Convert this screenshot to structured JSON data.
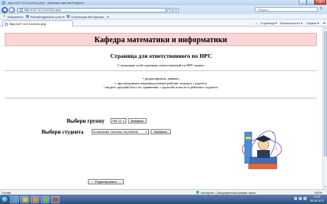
{
  "window": {
    "title": "http://127.0.0.1/c/1111.php - Windows Internet Explorer"
  },
  "address_bar": {
    "url": "http://127.0.0.1/c/1111.php",
    "search_placeholder": "Яндекс"
  },
  "favorites_bar": {
    "label": "Избранное",
    "items": [
      "Рекомендуемые узлы ▾",
      "Коллекция веб-фрагм... ▾"
    ]
  },
  "tab": {
    "title": "http://127.0.0.1/c/1111.php"
  },
  "command_bar": {
    "items": [
      "Страница ▾",
      "Безопасность ▾",
      "Сервис ▾",
      "?▾"
    ]
  },
  "page": {
    "banner": "Кафедра математики и информатики",
    "heading": "Страница для ответственного по НРС",
    "note": "С помощью этой страницы ответственный по НРС может:",
    "bullets": [
      "редактировать данные;",
      "просматривать индивидуальный рейтинг каждого студента;",
      "видеть средний балл по сравнению с группой и место в рейтинге студента."
    ],
    "group_label": "Выбери группу",
    "group_value": "ПМ-02",
    "group_button": "Выбрать",
    "student_label": "Выбери студента",
    "student_value": "Колмакова Татьяна Сергеевна",
    "student_button": "Выбрать",
    "edit_button": "Редактировать"
  },
  "status_bar": {
    "left": "Готово",
    "zone": "Интернет | Защищенный режим: выкл.",
    "zoom": "100%"
  },
  "taskbar": {
    "time": "13:47",
    "date": "05.06.2012"
  },
  "icons": [
    "ie-icon",
    "back-icon",
    "forward-icon",
    "refresh-icon",
    "stop-icon",
    "search-icon",
    "favorites-star-icon",
    "home-icon",
    "globe-icon"
  ],
  "colors": {
    "banner_bg": "#fbd6d6",
    "taskbar": "#2c4e80"
  }
}
